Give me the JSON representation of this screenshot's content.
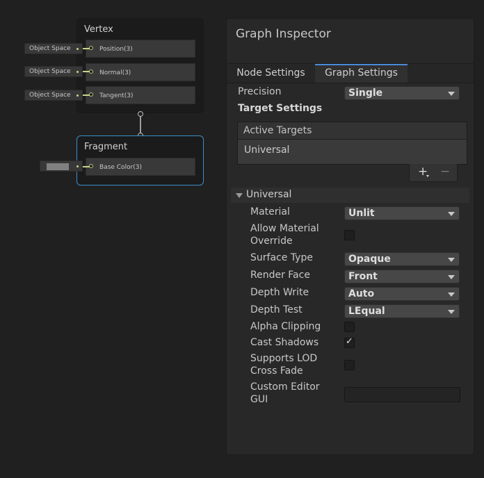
{
  "graph": {
    "vertex_node": {
      "title": "Vertex",
      "slots": [
        {
          "label": "Position(3)",
          "input": "Object Space"
        },
        {
          "label": "Normal(3)",
          "input": "Object Space"
        },
        {
          "label": "Tangent(3)",
          "input": "Object Space"
        }
      ]
    },
    "fragment_node": {
      "title": "Fragment",
      "slots": [
        {
          "label": "Base Color(3)",
          "swatch_color": "#808080"
        }
      ]
    },
    "wire_color": "#c6d88a"
  },
  "inspector": {
    "title": "Graph Inspector",
    "tabs": [
      {
        "label": "Node Settings",
        "active": false
      },
      {
        "label": "Graph Settings",
        "active": true
      }
    ],
    "precision": {
      "label": "Precision",
      "value": "Single"
    },
    "target_settings_heading": "Target Settings",
    "active_targets": {
      "header": "Active Targets",
      "items": [
        "Universal"
      ]
    },
    "list_buttons": {
      "add": "+",
      "remove": "−"
    },
    "universal": {
      "heading": "Universal",
      "material": {
        "label": "Material",
        "value": "Unlit"
      },
      "allow_material_override": {
        "label_line1": "Allow Material",
        "label_line2": "Override",
        "checked": false
      },
      "surface_type": {
        "label": "Surface Type",
        "value": "Opaque"
      },
      "render_face": {
        "label": "Render Face",
        "value": "Front"
      },
      "depth_write": {
        "label": "Depth Write",
        "value": "Auto"
      },
      "depth_test": {
        "label": "Depth Test",
        "value": "LEqual"
      },
      "alpha_clipping": {
        "label": "Alpha Clipping",
        "checked": false
      },
      "cast_shadows": {
        "label": "Cast Shadows",
        "checked": true,
        "check_glyph": "✓"
      },
      "supports_lod": {
        "label_line1": "Supports LOD",
        "label_line2": "Cross Fade",
        "checked": false
      },
      "custom_editor": {
        "label_line1": "Custom Editor",
        "label_line2": "GUI",
        "value": ""
      }
    }
  },
  "colors": {
    "accent": "#4a8ad8",
    "fragment_border": "#3f8fc8",
    "port": "#b8c97a"
  }
}
